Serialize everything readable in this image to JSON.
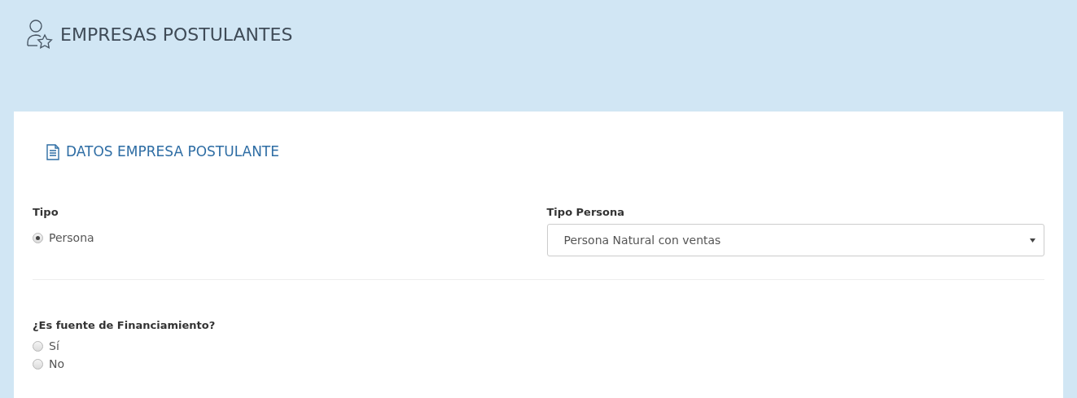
{
  "page": {
    "title": "EMPRESAS POSTULANTES"
  },
  "section": {
    "title": "DATOS EMPRESA POSTULANTE"
  },
  "tipo": {
    "label": "Tipo",
    "options": [
      {
        "label": "Persona",
        "selected": true
      }
    ]
  },
  "tipo_persona": {
    "label": "Tipo Persona",
    "value": "Persona Natural con ventas"
  },
  "financiamiento": {
    "label": "¿Es fuente de Financiamiento?",
    "options": [
      {
        "label": "Sí",
        "selected": false
      },
      {
        "label": "No",
        "selected": false
      }
    ]
  }
}
